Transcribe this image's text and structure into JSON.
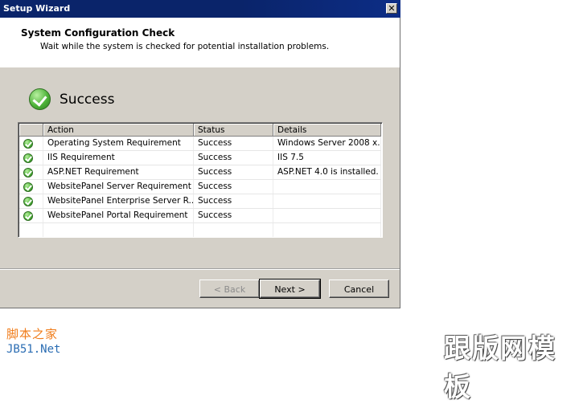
{
  "window": {
    "title": "Setup Wizard",
    "close_glyph": "✕"
  },
  "header": {
    "title": "System Configuration Check",
    "subtitle": "Wait while the system is checked for potential installation problems."
  },
  "result": {
    "icon": "success-check-icon",
    "label": "Success"
  },
  "table": {
    "columns": [
      "Action",
      "Status",
      "Details"
    ],
    "rows": [
      {
        "action": "Operating System Requirement",
        "status": "Success",
        "details": "Windows Server 2008 x..."
      },
      {
        "action": "IIS Requirement",
        "status": "Success",
        "details": "IIS 7.5"
      },
      {
        "action": "ASP.NET Requirement",
        "status": "Success",
        "details": "ASP.NET 4.0 is installed."
      },
      {
        "action": "WebsitePanel Server Requirement",
        "status": "Success",
        "details": ""
      },
      {
        "action": "WebsitePanel Enterprise Server R...",
        "status": "Success",
        "details": ""
      },
      {
        "action": "WebsitePanel Portal Requirement",
        "status": "Success",
        "details": ""
      }
    ]
  },
  "buttons": {
    "back": "< Back",
    "next": "Next >",
    "cancel": "Cancel"
  },
  "watermark": {
    "left_cn": "脚本之家",
    "left_en": "JB51.Net",
    "right": "跟版网模板"
  },
  "colors": {
    "titlebar": "#0a246a",
    "dialog_bg": "#d4d0c8",
    "success_green": "#4fb43a"
  }
}
